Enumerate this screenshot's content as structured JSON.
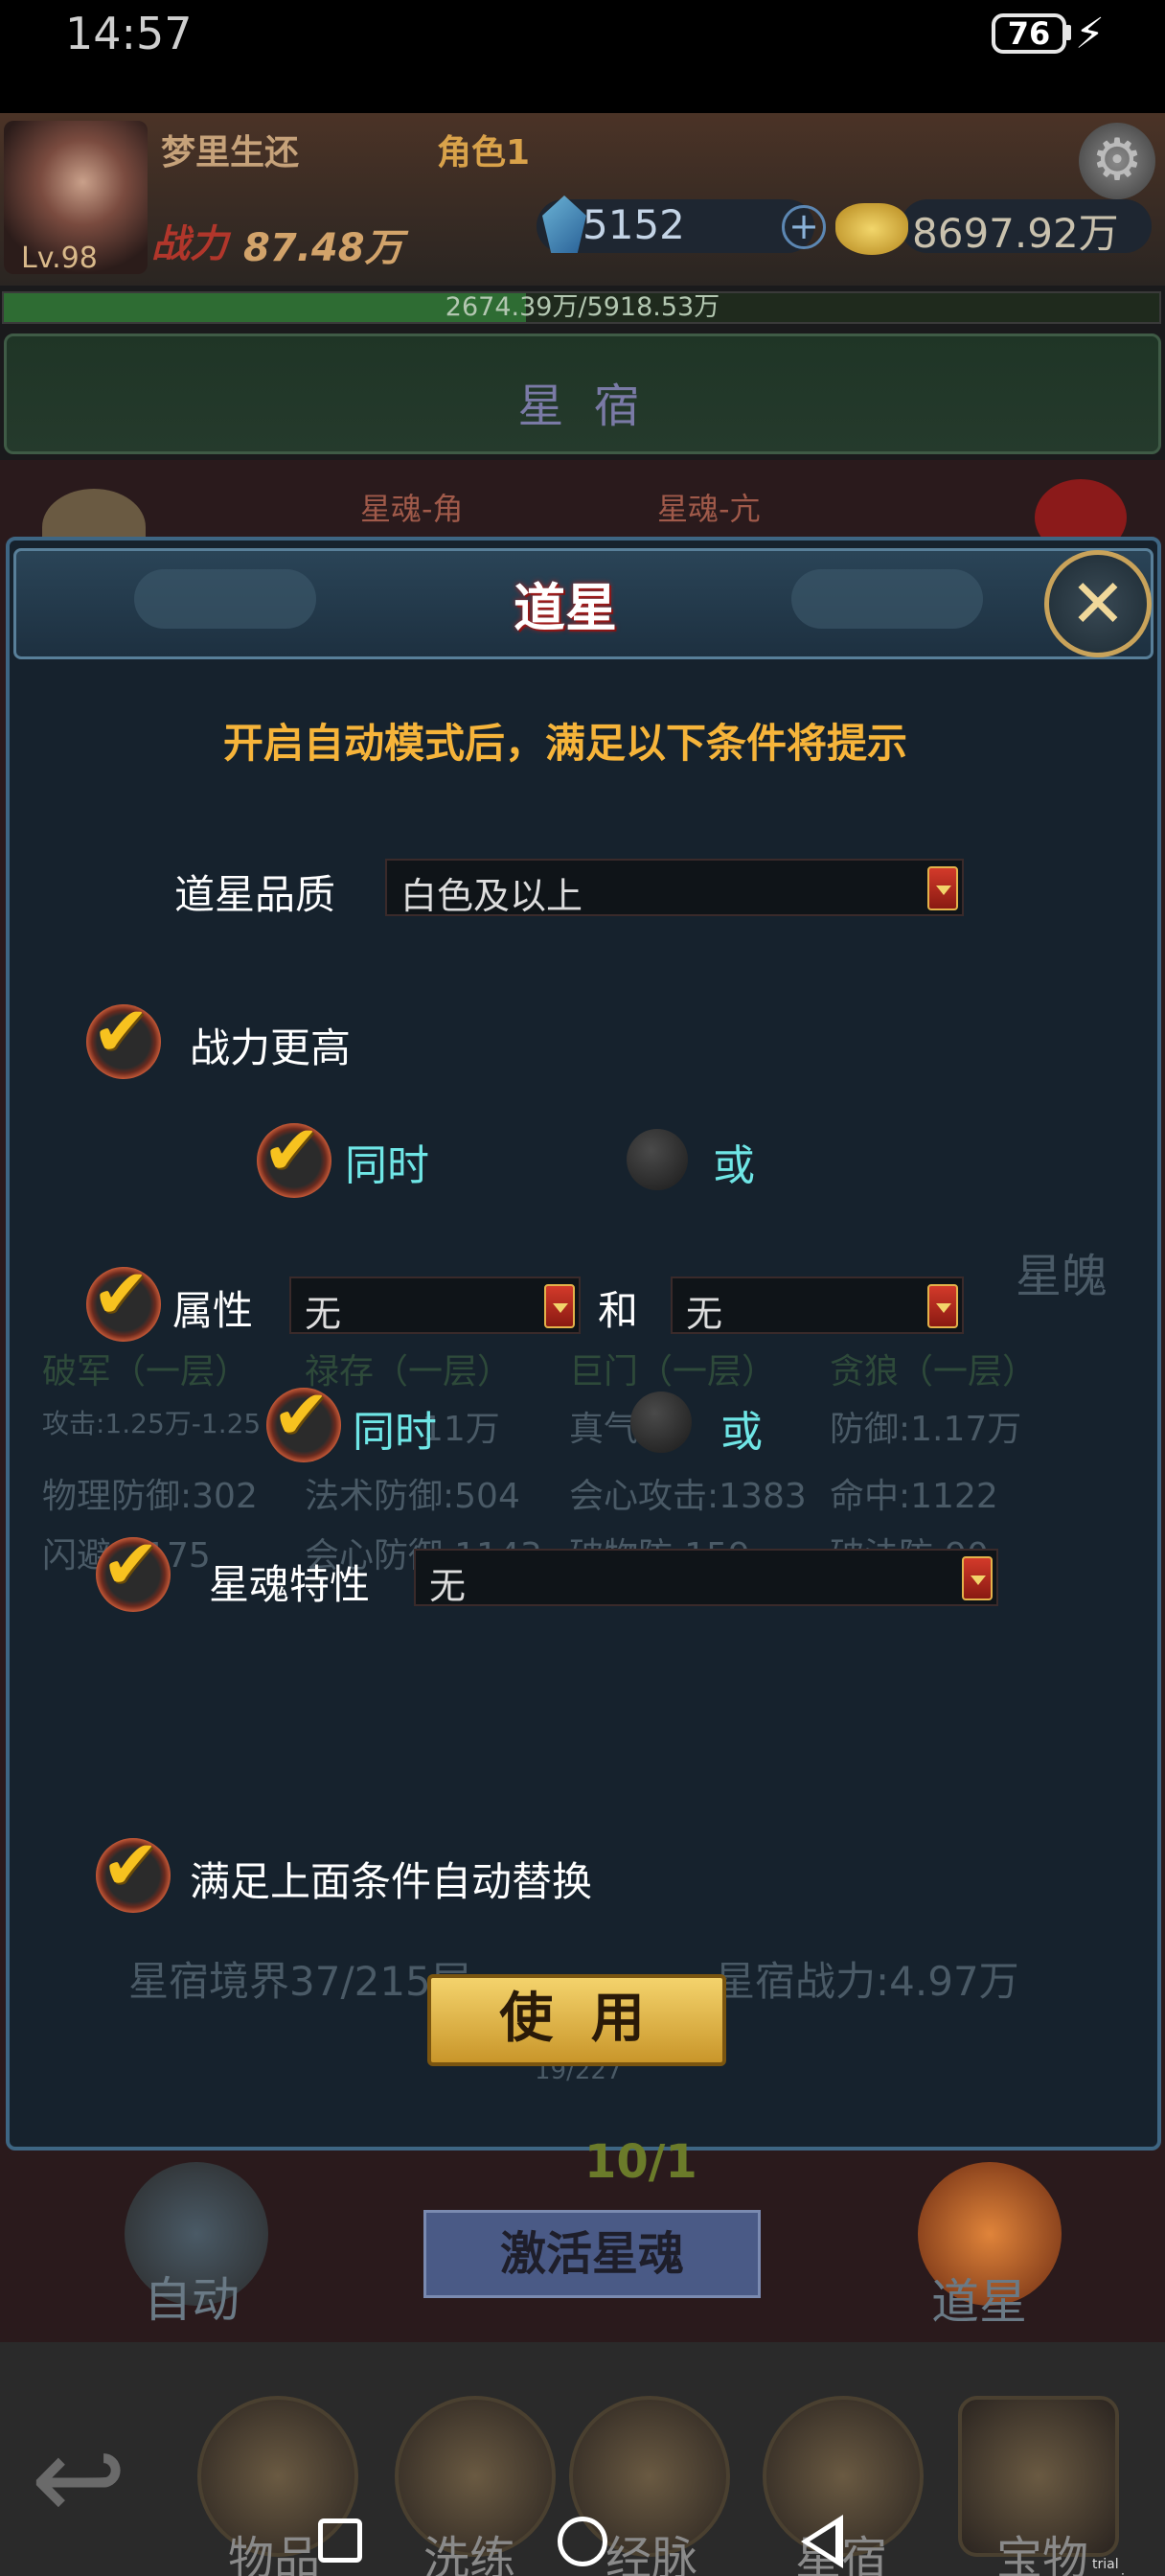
{
  "status_bar": {
    "time": "14:57",
    "battery": "76"
  },
  "player": {
    "name": "梦里生还",
    "role": "角色1",
    "level": "Lv.98",
    "power_label": "战力",
    "power": "87.48万",
    "gems": "5152",
    "gold": "8697.92万",
    "exp": "2674.39万/5918.53万",
    "exp_fraction": 0.452
  },
  "page": {
    "title": "星 宿",
    "tabs": [
      "星魂-角",
      "星魂-亢"
    ]
  },
  "modal": {
    "title": "道星",
    "hint": "开启自动模式后，满足以下条件将提示",
    "quality_label": "道星品质",
    "quality_value": "白色及以上",
    "power_higher_label": "战力更高",
    "and_label_1": "同时",
    "or_label_1": "或",
    "attr_label": "属性",
    "attr_value_1": "无",
    "and_word": "和",
    "attr_value_2": "无",
    "and_label_2": "同时",
    "or_label_2": "或",
    "trait_label": "星魂特性",
    "trait_value": "无",
    "auto_replace_label": "满足上面条件自动替换",
    "use_button": "使 用"
  },
  "background_text": {
    "stats_row1": [
      "破军（一层）",
      "禄存（一层）",
      "巨门（一层）",
      "贪狼（一层）"
    ],
    "stats_row2": [
      "攻击:1.25万-1.25",
      "11万",
      "真气",
      "防御:1.17万"
    ],
    "stats_row3": [
      "物理防御:302",
      "法术防御:504",
      "会心攻击:1383",
      "命中:1122"
    ],
    "stats_row4": [
      "闪避:1175",
      "会心防御:1143",
      "破物防:159",
      "破法防:90"
    ],
    "realm": "星宿境界37/215层",
    "realm_power": "星宿战力:4.97万",
    "progress": "19/227",
    "counter": "10/1",
    "soul": "星魄"
  },
  "actions": {
    "auto": "自动",
    "activate": "激活星魂",
    "daostar": "道星"
  },
  "bottom_nav": [
    "物品",
    "洗练",
    "经脉",
    "星宿",
    "宝物"
  ],
  "watermark": "trial version"
}
